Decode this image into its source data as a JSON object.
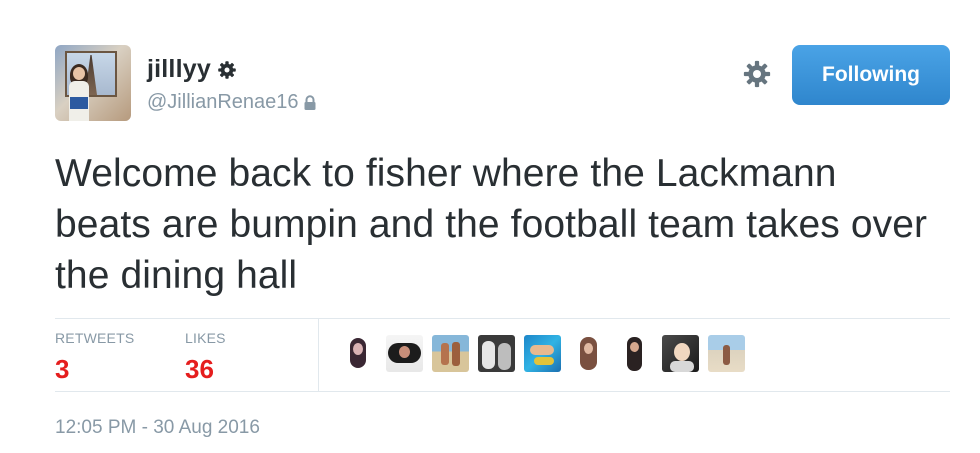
{
  "user": {
    "display_name": "jilllyy",
    "handle": "@JillianRenae16",
    "avatar_icon": "user-avatar",
    "verified_icon": "gear-badge-icon",
    "lock_icon": "lock-icon"
  },
  "header": {
    "settings_icon": "gear-icon",
    "follow_label": "Following"
  },
  "tweet": {
    "text": "Welcome back to fisher where the Lackmann beats are bumpin and the football team takes over the dining hall"
  },
  "stats": {
    "retweets_label": "RETWEETS",
    "retweets_count": "3",
    "likes_label": "LIKES",
    "likes_count": "36"
  },
  "likers_count_shown": 9,
  "timestamp": "12:05 PM - 30 Aug 2016",
  "colors": {
    "accent": "#3b94d9",
    "count_red": "#e51d1d",
    "muted": "#8899a6",
    "text": "#292f33",
    "divider": "#e1e8ed"
  }
}
